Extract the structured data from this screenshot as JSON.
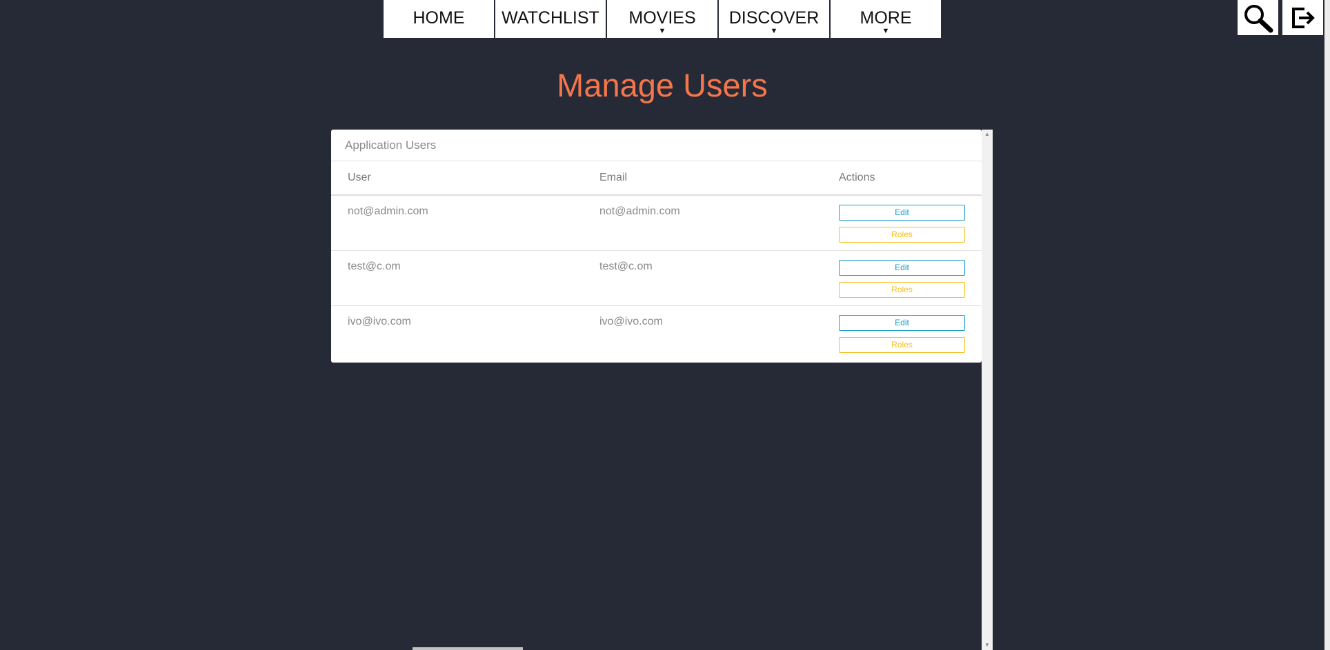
{
  "nav": {
    "items": [
      {
        "label": "HOME",
        "caret": ""
      },
      {
        "label": "WATCHLIST",
        "caret": ""
      },
      {
        "label": "MOVIES",
        "caret": "▼"
      },
      {
        "label": "DISCOVER",
        "caret": "▼"
      },
      {
        "label": "MORE",
        "caret": "▼"
      }
    ]
  },
  "toolbar": {
    "search_icon": "search-icon",
    "logout_icon": "logout-icon"
  },
  "page": {
    "title": "Manage Users"
  },
  "card": {
    "header": "Application Users",
    "columns": [
      "User",
      "Email",
      "Actions"
    ],
    "rows": [
      {
        "user": "not@admin.com",
        "email": "not@admin.com",
        "edit": "Edit",
        "roles": "Roles"
      },
      {
        "user": "test@c.om",
        "email": "test@c.om",
        "edit": "Edit",
        "roles": "Roles"
      },
      {
        "user": "ivo@ivo.com",
        "email": "ivo@ivo.com",
        "edit": "Edit",
        "roles": "Roles"
      }
    ]
  },
  "colors": {
    "background": "#262a37",
    "title": "#f4764a",
    "edit": "#1b9cc7",
    "roles": "#f6be1b"
  }
}
